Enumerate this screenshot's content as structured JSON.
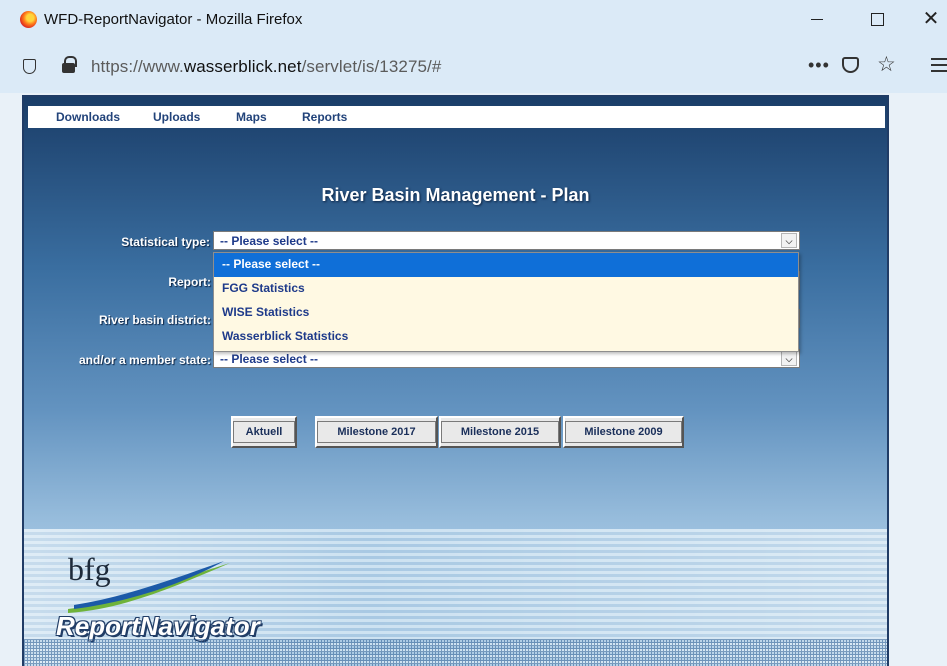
{
  "window": {
    "title": "WFD-ReportNavigator - Mozilla Firefox",
    "close_glyph": "✕"
  },
  "browser": {
    "url_prefix": "https://www.",
    "url_domain": "wasserblick.net",
    "url_path": "/servlet/is/13275/#",
    "more_glyph": "•••",
    "bookmark_glyph": "☆"
  },
  "menu": {
    "items": [
      "Downloads",
      "Uploads",
      "Maps",
      "Reports"
    ]
  },
  "heading": "River Basin Management - Plan",
  "form": {
    "statistical_type_label": "Statistical type:",
    "statistical_type_value": "-- Please select --",
    "report_label": "Report:",
    "river_basin_label": "River basin district:",
    "member_state_label": "and/or a member state:",
    "member_state_value": "-- Please select --",
    "dropdown_arrow": "⌵"
  },
  "dropdown": {
    "options": [
      "-- Please select --",
      "FGG Statistics",
      "WISE Statistics",
      "Wasserblick Statistics"
    ],
    "selected_index": 0
  },
  "buttons": [
    "Aktuell",
    "Milestone 2017",
    "Milestone 2015",
    "Milestone 2009"
  ],
  "branding": {
    "logo_text": "bfg",
    "product_name": "ReportNavigator"
  },
  "colors": {
    "accent": "#0f6fd8",
    "link": "#22437a",
    "dropdown_bg": "#fff9e3"
  }
}
